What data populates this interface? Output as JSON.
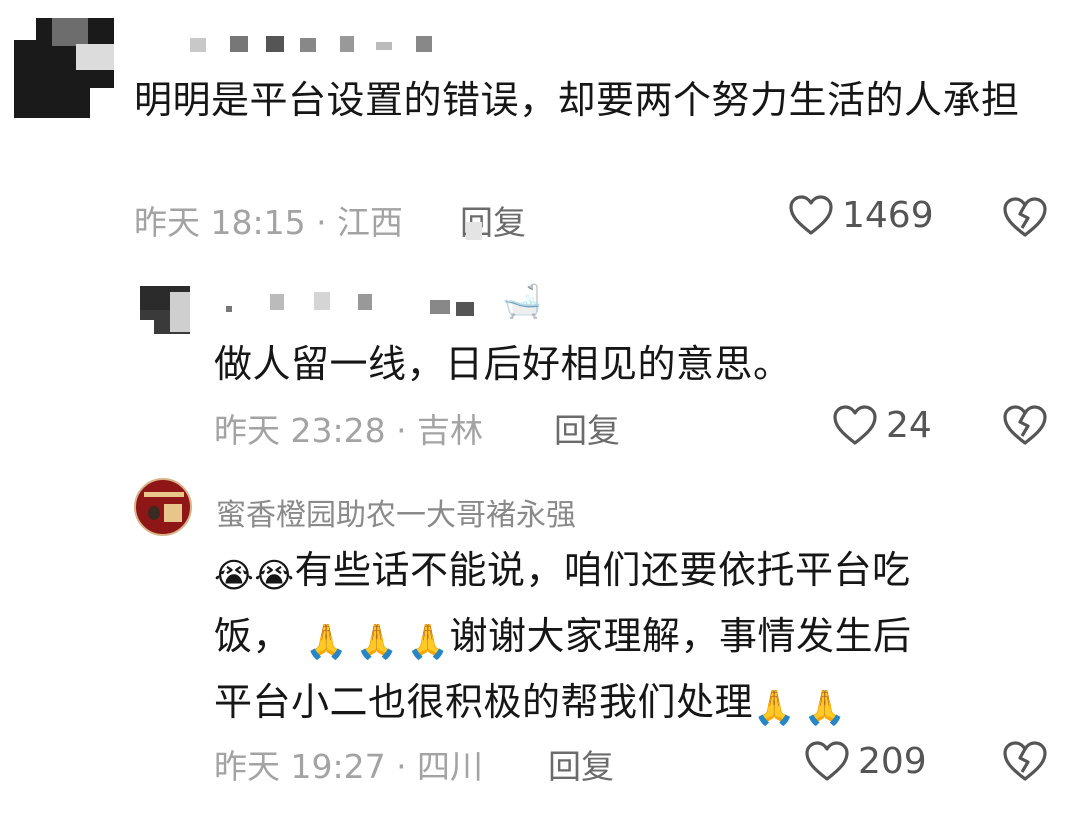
{
  "comments": [
    {
      "text": "明明是平台设置的错误，却要两个努力生活的人承担",
      "time": "昨天 18:15 · 江西",
      "reply_label": "回复",
      "likes": "1469"
    },
    {
      "text": "做人留一线，日后好相见的意思。",
      "time": "昨天 23:28 · 吉林",
      "reply_label": "回复",
      "likes": "24"
    },
    {
      "username": "蜜香橙园助农一大哥褚永强",
      "text_a": "有些话不能说，咱们还要依托平台吃",
      "text_b": "饭，",
      "text_c": "谢谢大家理解，事情发生后",
      "text_d": "平台小二也很积极的帮我们处理",
      "emoji_cry": "😭",
      "emoji_pray": "🙏",
      "time": "昨天 19:27 · 四川",
      "reply_label": "回复",
      "likes": "209"
    }
  ],
  "icons": {
    "like": "heart-outline-icon",
    "dislike": "broken-heart-icon"
  },
  "colors": {
    "text": "#161616",
    "meta": "#a3a3a3",
    "icon": "#555555"
  }
}
